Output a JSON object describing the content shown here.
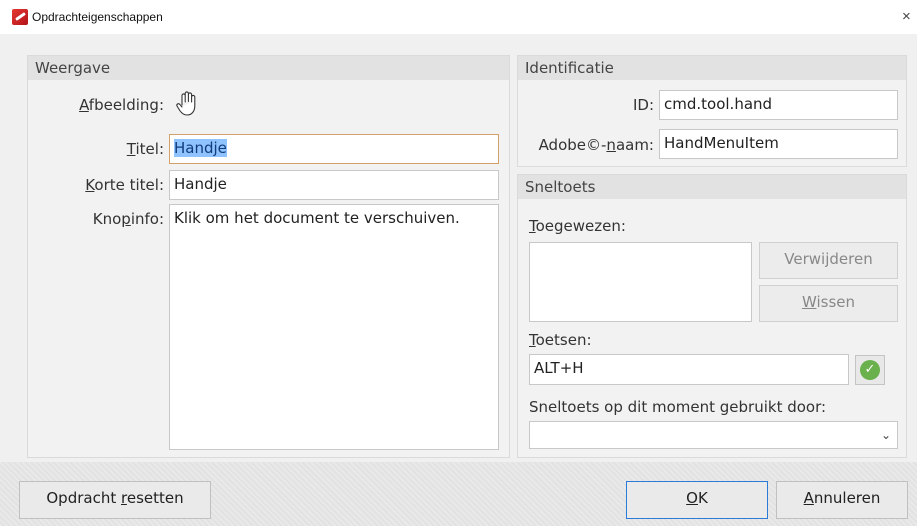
{
  "window": {
    "title": "Opdrachteigenschappen",
    "close_glyph": "×"
  },
  "weergave": {
    "header": "Weergave",
    "afbeelding_label": {
      "u": "A",
      "rest": "fbeelding:"
    },
    "afbeelding_icon": "hand-icon",
    "titel_label": {
      "u": "T",
      "rest": "itel:"
    },
    "titel_value": "Handje",
    "korte_titel_label": {
      "u": "K",
      "rest": "orte titel:"
    },
    "korte_titel_value": "Handje",
    "knopinfo_label": {
      "pre": "Kno",
      "u": "p",
      "rest": "info:"
    },
    "knopinfo_value": "Klik om het document te verschuiven."
  },
  "identificatie": {
    "header": "Identificatie",
    "id_label": "ID:",
    "id_value": "cmd.tool.hand",
    "adobe_label": {
      "pre": "Adobe©-",
      "u": "n",
      "rest": "aam:"
    },
    "adobe_value": "HandMenuItem"
  },
  "sneltoets": {
    "header": "Sneltoets",
    "toegewezen_label": {
      "u": "T",
      "rest": "oegewezen:"
    },
    "verwijderen_label": "Verwijderen",
    "wissen_label": {
      "u": "W",
      "rest": "issen"
    },
    "toetsen_label": {
      "u": "T",
      "rest": "oetsen:"
    },
    "toetsen_value": "ALT+H",
    "gebruikt_label": "Sneltoets op dit moment gebruikt door:",
    "gebruikt_value": ""
  },
  "footer": {
    "reset_label": {
      "pre": "Opdracht ",
      "u": "r",
      "rest": "esetten"
    },
    "ok_label": {
      "u": "O",
      "rest": "K"
    },
    "cancel_label": {
      "u": "A",
      "rest": "nnuleren"
    }
  },
  "colors": {
    "selection": "#8fc3ff",
    "check_green": "#6ab04c",
    "focus_border": "#d3a26a",
    "default_button_border": "#2a7ad8"
  }
}
